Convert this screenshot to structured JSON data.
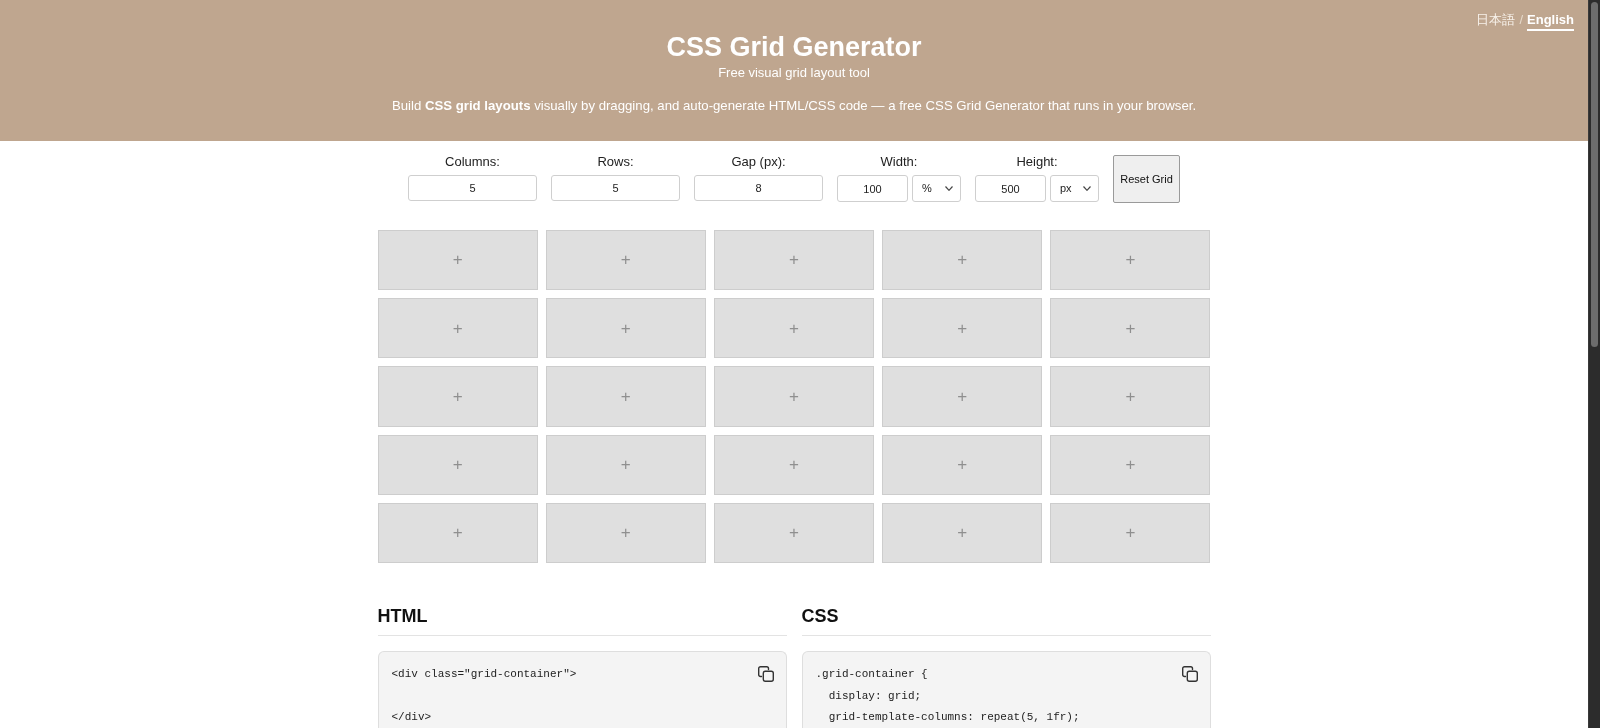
{
  "language_switch": {
    "options": [
      {
        "label": "日本語",
        "selected": false
      },
      {
        "label": "English",
        "selected": true
      }
    ],
    "separator": "/"
  },
  "header": {
    "title": "CSS Grid Generator",
    "subtitle": "Free visual grid layout tool",
    "description": "Build **CSS grid layouts** visually by dragging, and auto-generate HTML/CSS code — a free CSS Grid Generator that runs in your browser."
  },
  "controls": [
    {
      "kind": "number",
      "label": "Columns:",
      "value": "5"
    },
    {
      "kind": "number",
      "label": "Rows:",
      "value": "5"
    },
    {
      "kind": "number",
      "label": "Gap (px):",
      "value": "8"
    },
    {
      "kind": "size",
      "label": "Width:",
      "value": "100",
      "unit": "%"
    },
    {
      "kind": "size",
      "label": "Height:",
      "value": "500",
      "unit": "px"
    }
  ],
  "reset_button": {
    "label": "Reset Grid"
  },
  "grid": {
    "rows": [
      [
        "+",
        "+",
        "+",
        "+",
        "+"
      ],
      [
        "+",
        "+",
        "+",
        "+",
        "+"
      ],
      [
        "+",
        "+",
        "+",
        "+",
        "+"
      ],
      [
        "+",
        "+",
        "+",
        "+",
        "+"
      ],
      [
        "+",
        "+",
        "+",
        "+",
        "+"
      ]
    ]
  },
  "code_panels": [
    {
      "title": "HTML",
      "code": "<div class=\"grid-container\">\n\n</div>"
    },
    {
      "title": "CSS",
      "code": ".grid-container {\n  display: grid;\n  grid-template-columns: repeat(5, 1fr);"
    }
  ]
}
